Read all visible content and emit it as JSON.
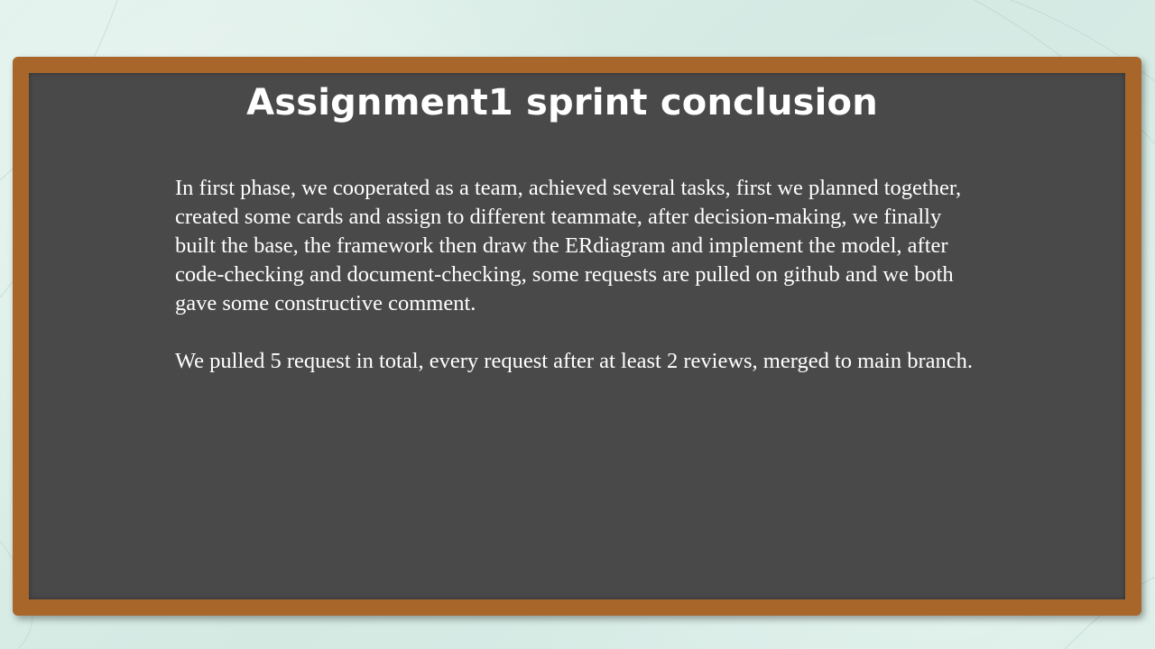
{
  "slide": {
    "title": "Assignment1 sprint conclusion",
    "paragraphs": [
      "In first phase, we cooperated as a team, achieved several tasks, first we planned together, created some cards and assign to different teammate, after decision-making, we finally built the base, the framework then draw the ERdiagram and implement the model, after code-checking and document-checking, some requests are pulled on github and we both gave some constructive comment.",
      "We pulled 5 request in total, every request after at least 2 reviews, merged to main branch."
    ]
  },
  "colors": {
    "background": "#d9ede7",
    "frame": "#a8662a",
    "board": "#494949",
    "text": "#ffffff"
  }
}
